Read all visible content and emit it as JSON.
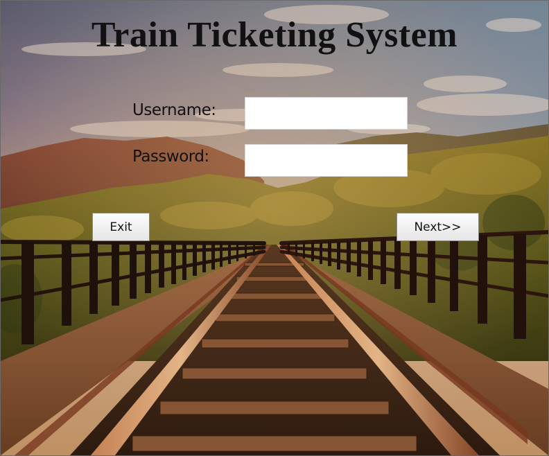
{
  "app": {
    "title": "Train Ticketing System"
  },
  "login": {
    "username_label": "Username:",
    "username_value": "",
    "password_label": "Password:",
    "password_value": ""
  },
  "buttons": {
    "exit_label": "Exit",
    "next_label": "Next>>"
  },
  "background": {
    "description_icon": "railway-bridge-image"
  }
}
